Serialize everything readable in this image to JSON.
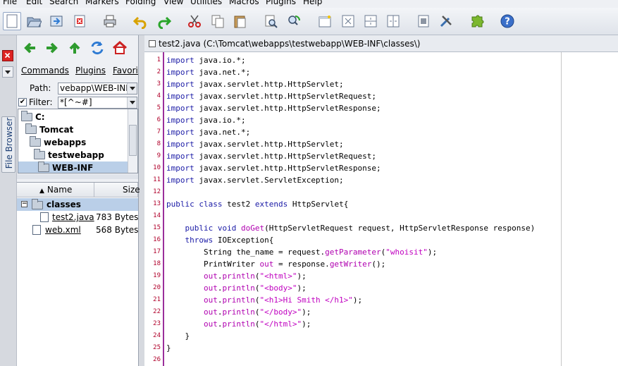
{
  "menu": [
    "File",
    "Edit",
    "Search",
    "Markers",
    "Folding",
    "View",
    "Utilities",
    "Macros",
    "Plugins",
    "Help"
  ],
  "toolbar": [
    "new-file-icon",
    "open-file-icon",
    "reload-icon",
    "close-file-icon",
    "print-icon",
    "undo-icon",
    "redo-icon",
    "cut-icon",
    "copy-icon",
    "paste-icon",
    "find-icon",
    "find-replace-icon",
    "new-view-icon",
    "unsplit-icon",
    "split-horizontal-icon",
    "split-vertical-icon",
    "buffer-options-icon",
    "global-options-icon",
    "plugin-manager-icon",
    "help-icon"
  ],
  "filebrowser": {
    "tab_label": "File Browser",
    "menus": [
      "Commands",
      "Plugins",
      "Favorites"
    ],
    "path_label": "Path:",
    "path_value": "vebapp\\WEB-INF",
    "filter_label": "Filter:",
    "filter_value": "*[^~#]",
    "tree": [
      "C:",
      "Tomcat",
      "webapps",
      "testwebapp",
      "WEB-INF"
    ],
    "table": {
      "col_name": "Name",
      "col_size": "Size",
      "group": "classes",
      "rows": [
        {
          "name": "test2.java",
          "size": "783 Bytes"
        },
        {
          "name": "web.xml",
          "size": "568 Bytes"
        }
      ]
    }
  },
  "editor": {
    "title": "test2.java (C:\\Tomcat\\webapps\\testwebapp\\WEB-INF\\classes\\)",
    "line_numbers": [
      "1",
      "2",
      "3",
      "4",
      "5",
      "6",
      "7",
      "8",
      "9",
      "10",
      "11",
      "12",
      "13",
      "14",
      "15",
      "16",
      "17",
      "18",
      "19",
      "20",
      "21",
      "22",
      "23",
      "24",
      "25",
      "26"
    ],
    "lines": [
      "import java.io.*;",
      "import java.net.*;",
      "import javax.servlet.http.HttpServlet;",
      "import javax.servlet.http.HttpServletRequest;",
      "import javax.servlet.http.HttpServletResponse;",
      "import java.io.*;",
      "import java.net.*;",
      "import javax.servlet.http.HttpServlet;",
      "import javax.servlet.http.HttpServletRequest;",
      "import javax.servlet.http.HttpServletResponse;",
      "import javax.servlet.ServletException;",
      "",
      "public class test2 extends HttpServlet{",
      "",
      "    public void doGet(HttpServletRequest request, HttpServletResponse response)",
      "    throws IOException{",
      "        String the_name = request.getParameter(\"whoisit\");",
      "        PrintWriter out = response.getWriter();",
      "        out.println(\"<html>\");",
      "        out.println(\"<body>\");",
      "        out.println(\"<h1>Hi Smith </h1>\");",
      "        out.println(\"</body>\");",
      "        out.println(\"</html>\");",
      "    }",
      "}",
      ""
    ]
  },
  "colors": {
    "keyword": "#1a1aa6",
    "method": "#b000b0",
    "string": "#c000c0",
    "line_number": "#b0002a",
    "gutter_border": "#9b2f9b",
    "selection": "#bacfe8"
  }
}
